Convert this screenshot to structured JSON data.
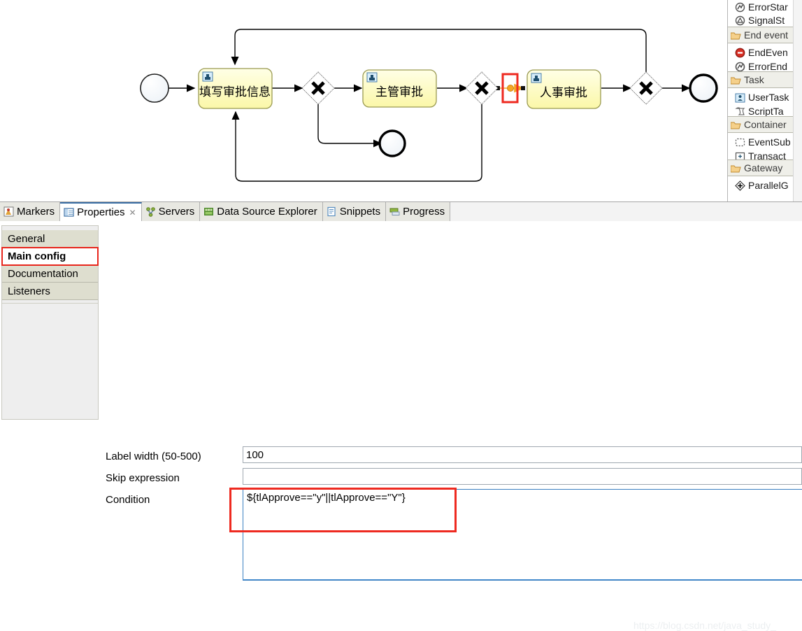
{
  "diagram": {
    "nodes": [
      {
        "id": "start",
        "type": "start-event",
        "label": ""
      },
      {
        "id": "task1",
        "type": "user-task",
        "label": "填写审批信息"
      },
      {
        "id": "gw1",
        "type": "exclusive-gateway",
        "label": ""
      },
      {
        "id": "task2",
        "type": "user-task",
        "label": "主管审批"
      },
      {
        "id": "gw2",
        "type": "exclusive-gateway",
        "label": ""
      },
      {
        "id": "task3",
        "type": "user-task",
        "label": "人事审批"
      },
      {
        "id": "gw3",
        "type": "exclusive-gateway",
        "label": ""
      },
      {
        "id": "end1",
        "type": "end-event",
        "label": ""
      },
      {
        "id": "end2",
        "type": "end-event",
        "label": ""
      }
    ],
    "selected_flow": {
      "from": "gw2",
      "to": "task3",
      "state": "selected",
      "color": "#f5a623"
    }
  },
  "palette": {
    "groups": [
      {
        "label": "",
        "items": [
          {
            "label": "ErrorStar",
            "icon": "error-start-icon"
          },
          {
            "label": "SignalSt",
            "icon": "signal-start-icon"
          }
        ]
      },
      {
        "label": "End event",
        "icon": "folder-icon",
        "items": [
          {
            "label": "EndEven",
            "icon": "end-event-icon"
          },
          {
            "label": "ErrorEnd",
            "icon": "error-end-icon"
          }
        ]
      },
      {
        "label": "Task",
        "icon": "folder-icon",
        "items": [
          {
            "label": "UserTask",
            "icon": "user-task-icon"
          },
          {
            "label": "ScriptTa",
            "icon": "script-task-icon"
          }
        ]
      },
      {
        "label": "Container",
        "icon": "folder-icon",
        "items": [
          {
            "label": "EventSub",
            "icon": "event-subprocess-icon"
          },
          {
            "label": "Transact",
            "icon": "transaction-icon"
          }
        ]
      },
      {
        "label": "Gateway",
        "icon": "folder-icon",
        "items": [
          {
            "label": "ParallelG",
            "icon": "parallel-gateway-icon"
          }
        ]
      }
    ]
  },
  "view_tabs": [
    {
      "label": "Markers",
      "icon": "markers-icon",
      "active": false,
      "closable": false
    },
    {
      "label": "Properties",
      "icon": "properties-icon",
      "active": true,
      "closable": true
    },
    {
      "label": "Servers",
      "icon": "servers-icon",
      "active": false,
      "closable": false
    },
    {
      "label": "Data Source Explorer",
      "icon": "data-source-icon",
      "active": false,
      "closable": false
    },
    {
      "label": "Snippets",
      "icon": "snippets-icon",
      "active": false,
      "closable": false
    },
    {
      "label": "Progress",
      "icon": "progress-icon",
      "active": false,
      "closable": false
    }
  ],
  "side_tabs": [
    {
      "label": "General",
      "selected": false
    },
    {
      "label": "Main config",
      "selected": true
    },
    {
      "label": "Documentation",
      "selected": false
    },
    {
      "label": "Listeners",
      "selected": false
    }
  ],
  "form": {
    "label_width": {
      "label": "Label width (50-500)",
      "value": "100",
      "placeholder": ""
    },
    "skip_expression": {
      "label": "Skip expression",
      "value": "",
      "placeholder": ""
    },
    "condition": {
      "label": "Condition",
      "value": "${tlApprove==\"y\"||tlApprove==\"Y\"}",
      "placeholder": ""
    }
  },
  "highlights": {
    "color": "#ee2a20",
    "targets": [
      "main-config-tab",
      "condition-field",
      "selected-sequence-flow"
    ]
  },
  "watermark": "https://blog.csdn.net/java_study_"
}
